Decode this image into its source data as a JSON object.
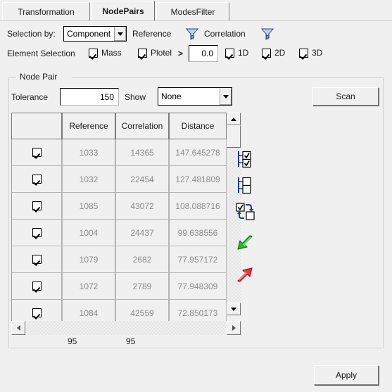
{
  "tabs": [
    {
      "label": "Transformation",
      "active": false
    },
    {
      "label": "NodePairs",
      "active": true
    },
    {
      "label": "ModesFilter",
      "active": false
    }
  ],
  "selection_row": {
    "label": "Selection by:",
    "combo_value": "Component",
    "reference_label": "Reference",
    "reference_filter_icon": "funnel-icon",
    "correlation_label": "Correlation",
    "correlation_filter_icon": "funnel-icon"
  },
  "element_selection": {
    "label": "Element Selection",
    "mass": {
      "label": "Mass",
      "checked": true
    },
    "plotel": {
      "label": "Plotel",
      "checked": true
    },
    "gt_symbol": ">",
    "threshold_value": "0.0",
    "dims": [
      {
        "label": "1D",
        "checked": true
      },
      {
        "label": "2D",
        "checked": true
      },
      {
        "label": "3D",
        "checked": true
      }
    ]
  },
  "node_pair": {
    "group_title": "Node Pair",
    "tolerance_label": "Tolerance",
    "tolerance_value": "150",
    "show_label": "Show",
    "show_value": "None",
    "scan_label": "Scan"
  },
  "table": {
    "columns": [
      "",
      "Reference",
      "Correlation",
      "Distance"
    ],
    "rows": [
      {
        "checked": true,
        "reference": "1033",
        "correlation": "14365",
        "distance": "147.645278"
      },
      {
        "checked": true,
        "reference": "1032",
        "correlation": "22454",
        "distance": "127.481809"
      },
      {
        "checked": true,
        "reference": "1085",
        "correlation": "43072",
        "distance": "108.088716"
      },
      {
        "checked": true,
        "reference": "1004",
        "correlation": "24437",
        "distance": "99.638556"
      },
      {
        "checked": true,
        "reference": "1079",
        "correlation": "2682",
        "distance": "77.957172"
      },
      {
        "checked": true,
        "reference": "1072",
        "correlation": "2789",
        "distance": "77.948309"
      },
      {
        "checked": true,
        "reference": "1084",
        "correlation": "42559",
        "distance": "72.850173"
      }
    ],
    "counts": {
      "reference_count": "95",
      "correlation_count": "95"
    }
  },
  "side_tools": [
    {
      "name": "select-all-icon"
    },
    {
      "name": "deselect-all-icon"
    },
    {
      "name": "invert-selection-icon"
    },
    {
      "name": "green-arrow-icon"
    },
    {
      "name": "red-arrow-icon"
    }
  ],
  "footer": {
    "apply_label": "Apply"
  },
  "colors": {
    "background": "#f0f0f0",
    "cell_text": "#8a8a8a",
    "funnel_blue": "#8ba3c7",
    "green_arrow": "#35b035",
    "red_arrow": "#e8373f",
    "tree_blue": "#1f3b8c"
  }
}
